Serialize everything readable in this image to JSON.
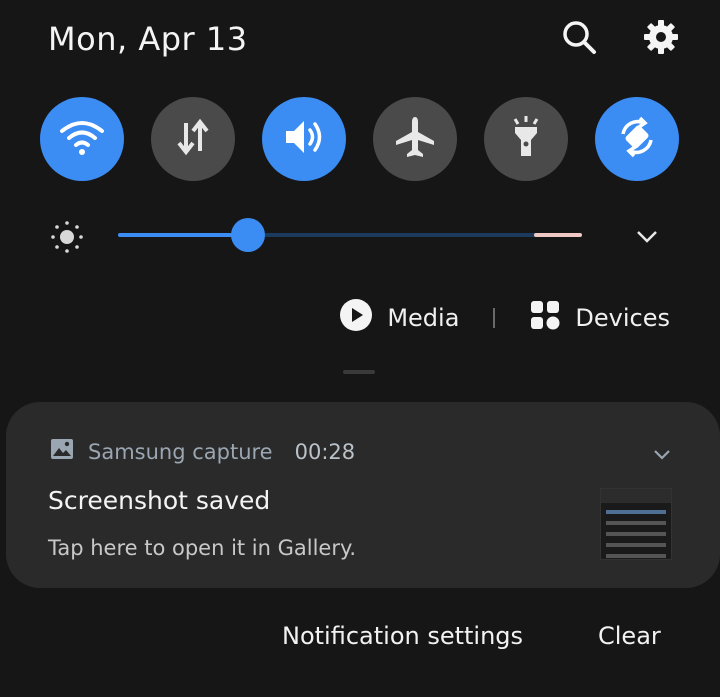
{
  "header": {
    "date": "Mon, Apr 13",
    "icons": [
      "search-icon",
      "gear-icon"
    ]
  },
  "quick_settings": {
    "tiles": [
      {
        "name": "wifi",
        "icon": "wifi-icon",
        "state": "on"
      },
      {
        "name": "mobile-data",
        "icon": "data-transfer-icon",
        "state": "off"
      },
      {
        "name": "sound",
        "icon": "volume-icon",
        "state": "on"
      },
      {
        "name": "airplane-mode",
        "icon": "airplane-icon",
        "state": "off"
      },
      {
        "name": "flashlight",
        "icon": "flashlight-icon",
        "state": "off"
      },
      {
        "name": "auto-rotate",
        "icon": "rotate-icon",
        "state": "on"
      }
    ],
    "colors": {
      "active": "#3b8cf3",
      "inactive": "#4a4a4a"
    }
  },
  "brightness": {
    "level": 0.28,
    "icon": "sun-icon",
    "expand_icon": "chevron-down-icon"
  },
  "media_row": {
    "media_label": "Media",
    "devices_label": "Devices"
  },
  "notification": {
    "app_name": "Samsung capture",
    "time": "00:28",
    "title": "Screenshot saved",
    "text": "Tap here to open it in Gallery."
  },
  "footer": {
    "settings_label": "Notification settings",
    "clear_label": "Clear"
  }
}
